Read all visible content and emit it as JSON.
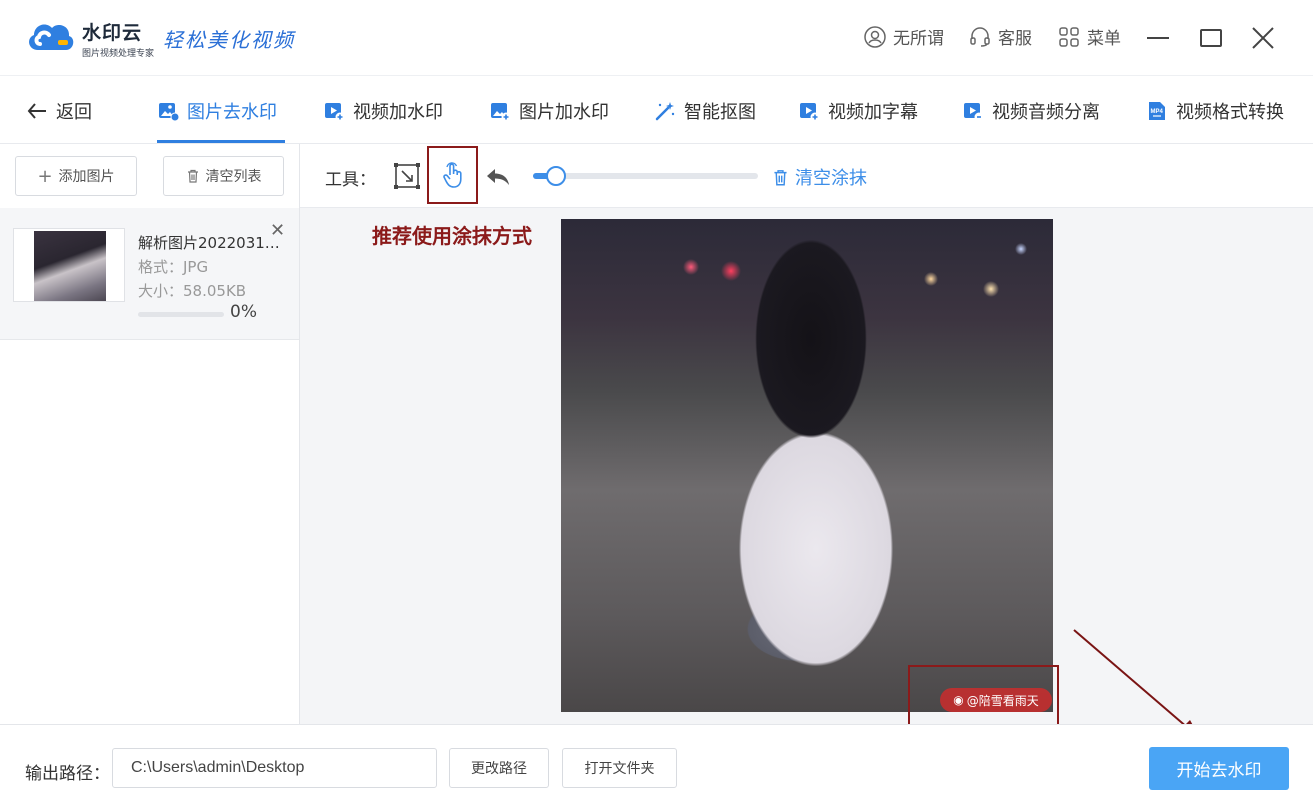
{
  "app": {
    "name": "水印云",
    "subtitle": "图片视频处理专家",
    "slogan": "轻松美化视频"
  },
  "header": {
    "user_label": "无所谓",
    "service_label": "客服",
    "menu_label": "菜单"
  },
  "nav": {
    "back_label": "返回",
    "tabs": [
      {
        "label": "图片去水印",
        "active": true
      },
      {
        "label": "视频加水印"
      },
      {
        "label": "图片加水印"
      },
      {
        "label": "智能抠图"
      },
      {
        "label": "视频加字幕"
      },
      {
        "label": "视频音频分离"
      },
      {
        "label": "视频格式转换"
      }
    ]
  },
  "sidebar": {
    "add_label": "添加图片",
    "clear_label": "清空列表",
    "files": [
      {
        "name": "解析图片2022031…",
        "format": "格式：JPG",
        "size": "大小：58.05KB",
        "progress": "0%"
      }
    ]
  },
  "toolbar": {
    "label": "工具：",
    "clear_label": "清空涂抹",
    "brush_size": 0.1
  },
  "canvas": {
    "hint": "推荐使用涂抹方式",
    "watermark_text": "@陪雪看雨天"
  },
  "footer": {
    "output_label": "输出路径：",
    "output_path": "C:\\Users\\admin\\Desktop",
    "change_label": "更改路径",
    "open_label": "打开文件夹",
    "start_label": "开始去水印"
  },
  "colors": {
    "accent": "#2f7fe0",
    "start_button": "#4aa5f5",
    "annotation": "#8b1a1a"
  }
}
